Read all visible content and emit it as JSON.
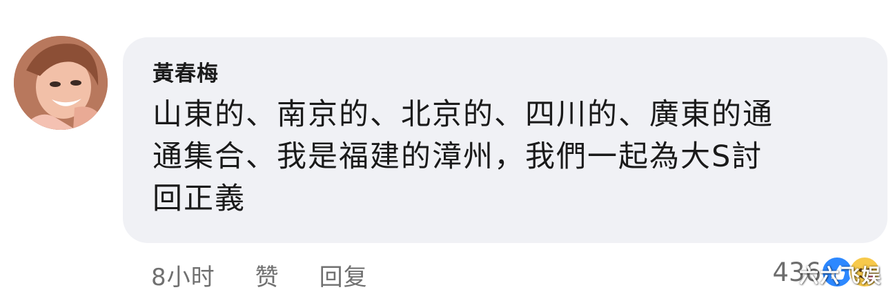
{
  "comment": {
    "author": "黃春梅",
    "text": "山東的、南京的、北京的、四川的、廣東的通\n通集合、我是福建的漳州，我們一起為大S討\n回正義",
    "meta": {
      "time": "8小时",
      "like_label": "赞",
      "reply_label": "回复"
    },
    "reactions": {
      "count": "436",
      "icons": [
        "like-icon",
        "care-icon"
      ]
    }
  },
  "watermark": {
    "text": "六六飞娱"
  },
  "colors": {
    "bubble": "#f0f1f5",
    "meta_text": "#707070",
    "like_blue": "#2d88ff"
  }
}
